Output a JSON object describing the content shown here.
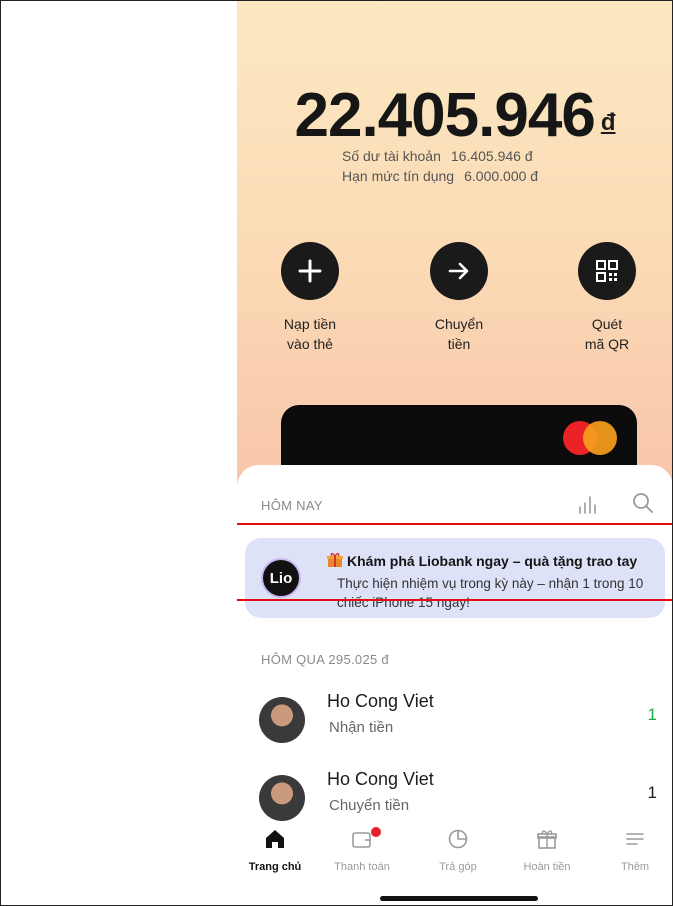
{
  "balance": {
    "amount": "22.405.946",
    "currency": "đ",
    "account_label": "Số dư tài khoản",
    "account_value": "16.405.946 đ",
    "credit_label": "Hạn mức tín dụng",
    "credit_value": "6.000.000 đ"
  },
  "actions": [
    {
      "label": "Nạp tiền\nvào thẻ",
      "icon": "plus-icon"
    },
    {
      "label": "Chuyển\ntiền",
      "icon": "arrow-right-icon"
    },
    {
      "label": "Quét\nmã QR",
      "icon": "qr-icon"
    }
  ],
  "today": {
    "title": "HÔM NAY"
  },
  "promo": {
    "avatar_text": "Lio",
    "title": "Khám phá Liobank ngay – quà tặng trao tay",
    "body": "Thực hiện nhiệm vụ trong kỳ này – nhận 1 trong 10 chiếc iPhone 15 ngay!"
  },
  "yesterday": {
    "title": "HÔM QUA 295.025 đ"
  },
  "transactions": [
    {
      "name": "Ho Cong Viet",
      "type": "Nhận tiền",
      "amount": "1",
      "amount_color": "#1fa84a"
    },
    {
      "name": "Ho Cong Viet",
      "type": "Chuyển tiền",
      "amount": "1",
      "amount_color": "#1c1c1c"
    }
  ],
  "tabs": [
    {
      "label": "Trang chủ",
      "icon": "home-icon",
      "active": true
    },
    {
      "label": "Thanh toán",
      "icon": "wallet-icon",
      "active": false
    },
    {
      "label": "Trả góp",
      "icon": "pie-chart-icon",
      "active": false
    },
    {
      "label": "Hoàn tiền",
      "icon": "gift-icon",
      "active": false
    },
    {
      "label": "Thêm",
      "icon": "menu-icon",
      "active": false
    }
  ],
  "colors": {
    "accent_red": "#e5202b",
    "received_green": "#1fa84a",
    "promo_bg": "#dde2f8"
  }
}
